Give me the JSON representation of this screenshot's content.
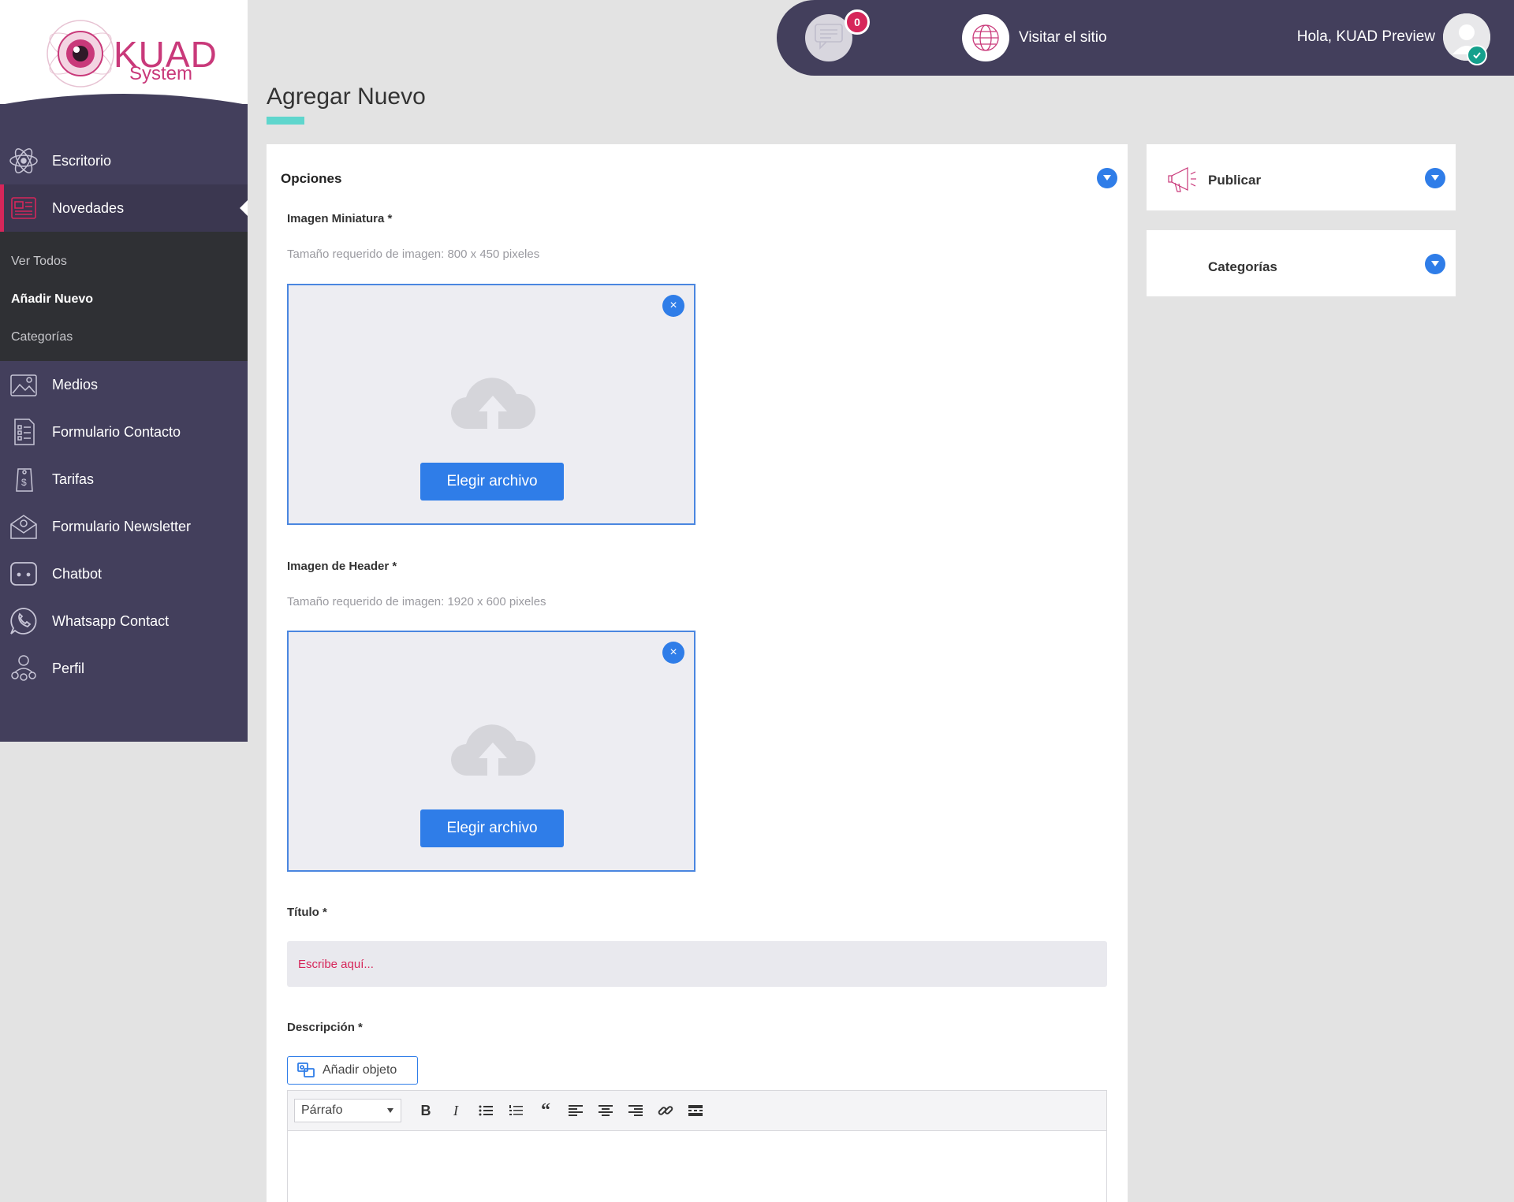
{
  "brand": {
    "name": "KUAD",
    "tagline": "System",
    "colors": {
      "brand": "#c9397a",
      "sidebar": "#433f5c",
      "accent": "#2f7de8",
      "alert": "#d6265a",
      "teal": "#5fd6cd"
    }
  },
  "sidebar": {
    "items": [
      {
        "label": "Escritorio",
        "icon": "atom-icon"
      },
      {
        "label": "Novedades",
        "icon": "newspaper-icon",
        "active": true
      },
      {
        "label": "Medios",
        "icon": "image-icon"
      },
      {
        "label": "Formulario Contacto",
        "icon": "form-icon"
      },
      {
        "label": "Tarifas",
        "icon": "price-tag-icon"
      },
      {
        "label": "Formulario Newsletter",
        "icon": "envelope-icon"
      },
      {
        "label": "Chatbot",
        "icon": "chat-bubble-icon"
      },
      {
        "label": "Whatsapp Contact",
        "icon": "whatsapp-icon"
      },
      {
        "label": "Perfil",
        "icon": "user-group-icon"
      }
    ],
    "submenu": [
      {
        "label": "Ver Todos"
      },
      {
        "label": "Añadir Nuevo",
        "current": true
      },
      {
        "label": "Categorías"
      }
    ]
  },
  "topbar": {
    "messages_count": "0",
    "visit_label": "Visitar el sitio",
    "greeting": "Hola, KUAD Preview"
  },
  "page": {
    "title": "Agregar Nuevo"
  },
  "main": {
    "section_title": "Opciones",
    "thumb": {
      "label": "Imagen Miniatura *",
      "hint": "Tamaño requerido de imagen: 800 x 450 pixeles",
      "button": "Elegir archivo"
    },
    "header": {
      "label": "Imagen de Header *",
      "hint": "Tamaño requerido de imagen: 1920 x 600 pixeles",
      "button": "Elegir archivo"
    },
    "title_field": {
      "label": "Título *",
      "placeholder": "Escribe aquí..."
    },
    "description": {
      "label": "Descripción *",
      "add_object": "Añadir objeto",
      "format_select": "Párrafo"
    }
  },
  "side": {
    "publish": "Publicar",
    "categories": "Categorías"
  }
}
